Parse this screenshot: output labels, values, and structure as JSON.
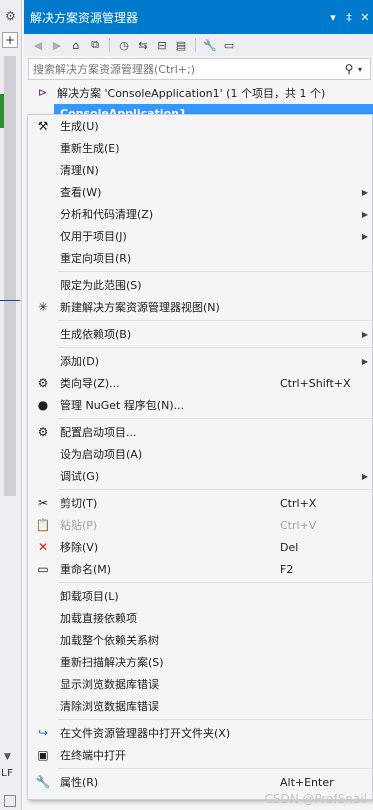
{
  "panel": {
    "title": "解决方案资源管理器",
    "pin_glyph": "▾ ‡ ✕"
  },
  "search": {
    "placeholder": "搜索解决方案资源管理器(Ctrl+;)"
  },
  "tree": {
    "solution_label": "解决方案 'ConsoleApplication1' (1 个项目，共 1 个)",
    "project_label": "ConsoleApplication1"
  },
  "menu": {
    "items": [
      {
        "label": "生成(U)",
        "shortcut": "",
        "submenu": false,
        "icon": "build-icon",
        "glyph": "⚒"
      },
      {
        "label": "重新生成(E)",
        "shortcut": "",
        "submenu": false,
        "icon": "",
        "glyph": ""
      },
      {
        "label": "清理(N)",
        "shortcut": "",
        "submenu": false,
        "icon": "",
        "glyph": ""
      },
      {
        "label": "查看(W)",
        "shortcut": "",
        "submenu": true,
        "icon": "",
        "glyph": ""
      },
      {
        "label": "分析和代码清理(Z)",
        "shortcut": "",
        "submenu": true,
        "icon": "",
        "glyph": ""
      },
      {
        "label": "仅用于项目(J)",
        "shortcut": "",
        "submenu": true,
        "icon": "",
        "glyph": ""
      },
      {
        "label": "重定向项目(R)",
        "shortcut": "",
        "submenu": false,
        "icon": "",
        "glyph": ""
      },
      {
        "sep": true
      },
      {
        "label": "限定为此范围(S)",
        "shortcut": "",
        "submenu": false,
        "icon": "",
        "glyph": ""
      },
      {
        "label": "新建解决方案资源管理器视图(N)",
        "shortcut": "",
        "submenu": false,
        "icon": "new-view-icon",
        "glyph": "✳"
      },
      {
        "sep": true
      },
      {
        "label": "生成依赖项(B)",
        "shortcut": "",
        "submenu": true,
        "icon": "",
        "glyph": ""
      },
      {
        "sep": true
      },
      {
        "label": "添加(D)",
        "shortcut": "",
        "submenu": true,
        "icon": "",
        "glyph": ""
      },
      {
        "label": "类向导(Z)...",
        "shortcut": "Ctrl+Shift+X",
        "submenu": false,
        "icon": "class-wizard-icon",
        "glyph": "⚙"
      },
      {
        "label": "管理 NuGet 程序包(N)...",
        "shortcut": "",
        "submenu": false,
        "icon": "nuget-icon",
        "glyph": "●"
      },
      {
        "sep": true
      },
      {
        "label": "配置启动项目...",
        "shortcut": "",
        "submenu": false,
        "icon": "gear-icon",
        "glyph": "⚙"
      },
      {
        "label": "设为启动项目(A)",
        "shortcut": "",
        "submenu": false,
        "icon": "",
        "glyph": ""
      },
      {
        "label": "调试(G)",
        "shortcut": "",
        "submenu": true,
        "icon": "",
        "glyph": ""
      },
      {
        "sep": true
      },
      {
        "label": "剪切(T)",
        "shortcut": "Ctrl+X",
        "submenu": false,
        "icon": "cut-icon",
        "glyph": "✂"
      },
      {
        "label": "粘贴(P)",
        "shortcut": "Ctrl+V",
        "submenu": false,
        "icon": "paste-icon",
        "glyph": "📋",
        "disabled": true
      },
      {
        "label": "移除(V)",
        "shortcut": "Del",
        "submenu": false,
        "icon": "remove-icon",
        "glyph": "✕",
        "color": "#e51400"
      },
      {
        "label": "重命名(M)",
        "shortcut": "F2",
        "submenu": false,
        "icon": "rename-icon",
        "glyph": "▭"
      },
      {
        "sep": true
      },
      {
        "label": "卸载项目(L)",
        "shortcut": "",
        "submenu": false,
        "icon": "",
        "glyph": ""
      },
      {
        "label": "加载直接依赖项",
        "shortcut": "",
        "submenu": false,
        "icon": "",
        "glyph": ""
      },
      {
        "label": "加载整个依赖关系树",
        "shortcut": "",
        "submenu": false,
        "icon": "",
        "glyph": ""
      },
      {
        "label": "重新扫描解决方案(S)",
        "shortcut": "",
        "submenu": false,
        "icon": "",
        "glyph": ""
      },
      {
        "label": "显示浏览数据库错误",
        "shortcut": "",
        "submenu": false,
        "icon": "",
        "glyph": ""
      },
      {
        "label": "清除浏览数据库错误",
        "shortcut": "",
        "submenu": false,
        "icon": "",
        "glyph": ""
      },
      {
        "sep": true
      },
      {
        "label": "在文件资源管理器中打开文件夹(X)",
        "shortcut": "",
        "submenu": false,
        "icon": "open-folder-icon",
        "glyph": "↪",
        "color": "#1e70c8"
      },
      {
        "label": "在终端中打开",
        "shortcut": "",
        "submenu": false,
        "icon": "terminal-icon",
        "glyph": "▣"
      },
      {
        "sep": true
      },
      {
        "label": "属性(R)",
        "shortcut": "Alt+Enter",
        "submenu": false,
        "icon": "wrench-icon",
        "glyph": "🔧"
      }
    ]
  },
  "left_strip": {
    "lf_text": "LF"
  },
  "watermark": "CSDN @ProfSnail",
  "colors": {
    "accent": "#007acc",
    "selection": "#3399ff",
    "remove_red": "#e51400"
  }
}
